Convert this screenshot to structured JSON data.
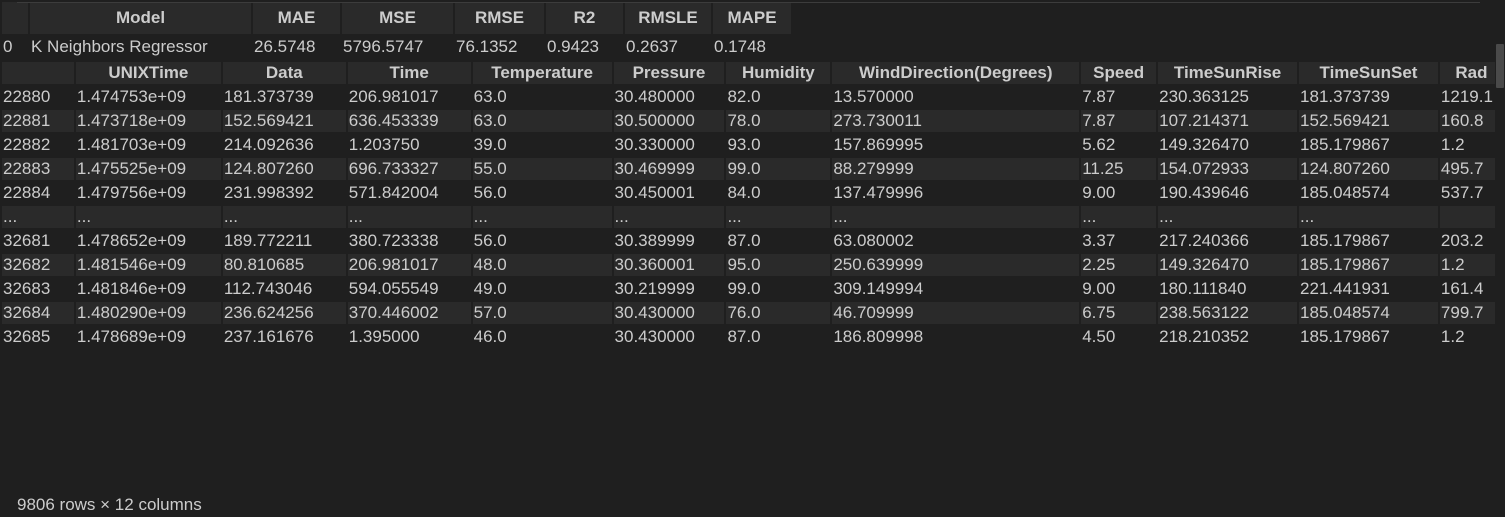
{
  "metrics": {
    "columns": [
      "Model",
      "MAE",
      "MSE",
      "RMSE",
      "R2",
      "RMSLE",
      "MAPE"
    ],
    "rows": [
      {
        "index": "0",
        "cells": [
          "K Neighbors Regressor",
          "26.5748",
          "5796.5747",
          "76.1352",
          "0.9423",
          "0.2637",
          "0.1748"
        ]
      }
    ]
  },
  "dataframe": {
    "columns": [
      "UNIXTime",
      "Data",
      "Time",
      "Temperature",
      "Pressure",
      "Humidity",
      "WindDirection(Degrees)",
      "Speed",
      "TimeSunRise",
      "TimeSunSet",
      "Rad"
    ],
    "rows": [
      {
        "index": "22880",
        "cells": [
          "1.474753e+09",
          "181.373739",
          "206.981017",
          "63.0",
          "30.480000",
          "82.0",
          "13.570000",
          "7.87",
          "230.363125",
          "181.373739",
          "1219.1"
        ]
      },
      {
        "index": "22881",
        "cells": [
          "1.473718e+09",
          "152.569421",
          "636.453339",
          "63.0",
          "30.500000",
          "78.0",
          "273.730011",
          "7.87",
          "107.214371",
          "152.569421",
          "160.8"
        ]
      },
      {
        "index": "22882",
        "cells": [
          "1.481703e+09",
          "214.092636",
          "1.203750",
          "39.0",
          "30.330000",
          "93.0",
          "157.869995",
          "5.62",
          "149.326470",
          "185.179867",
          "1.2"
        ]
      },
      {
        "index": "22883",
        "cells": [
          "1.475525e+09",
          "124.807260",
          "696.733327",
          "55.0",
          "30.469999",
          "99.0",
          "88.279999",
          "11.25",
          "154.072933",
          "124.807260",
          "495.7"
        ]
      },
      {
        "index": "22884",
        "cells": [
          "1.479756e+09",
          "231.998392",
          "571.842004",
          "56.0",
          "30.450001",
          "84.0",
          "137.479996",
          "9.00",
          "190.439646",
          "185.048574",
          "537.7"
        ]
      },
      {
        "index": "...",
        "cells": [
          "...",
          "...",
          "...",
          "...",
          "...",
          "...",
          "...",
          "...",
          "...",
          "...",
          ""
        ]
      },
      {
        "index": "32681",
        "cells": [
          "1.478652e+09",
          "189.772211",
          "380.723338",
          "56.0",
          "30.389999",
          "87.0",
          "63.080002",
          "3.37",
          "217.240366",
          "185.179867",
          "203.2"
        ]
      },
      {
        "index": "32682",
        "cells": [
          "1.481546e+09",
          "80.810685",
          "206.981017",
          "48.0",
          "30.360001",
          "95.0",
          "250.639999",
          "2.25",
          "149.326470",
          "185.179867",
          "1.2"
        ]
      },
      {
        "index": "32683",
        "cells": [
          "1.481846e+09",
          "112.743046",
          "594.055549",
          "49.0",
          "30.219999",
          "99.0",
          "309.149994",
          "9.00",
          "180.111840",
          "221.441931",
          "161.4"
        ]
      },
      {
        "index": "32684",
        "cells": [
          "1.480290e+09",
          "236.624256",
          "370.446002",
          "57.0",
          "30.430000",
          "76.0",
          "46.709999",
          "6.75",
          "238.563122",
          "185.048574",
          "799.7"
        ]
      },
      {
        "index": "32685",
        "cells": [
          "1.478689e+09",
          "237.161676",
          "1.395000",
          "46.0",
          "30.430000",
          "87.0",
          "186.809998",
          "4.50",
          "218.210352",
          "185.179867",
          "1.2"
        ]
      }
    ]
  },
  "footer": {
    "text": "9806 rows × 12 columns"
  }
}
